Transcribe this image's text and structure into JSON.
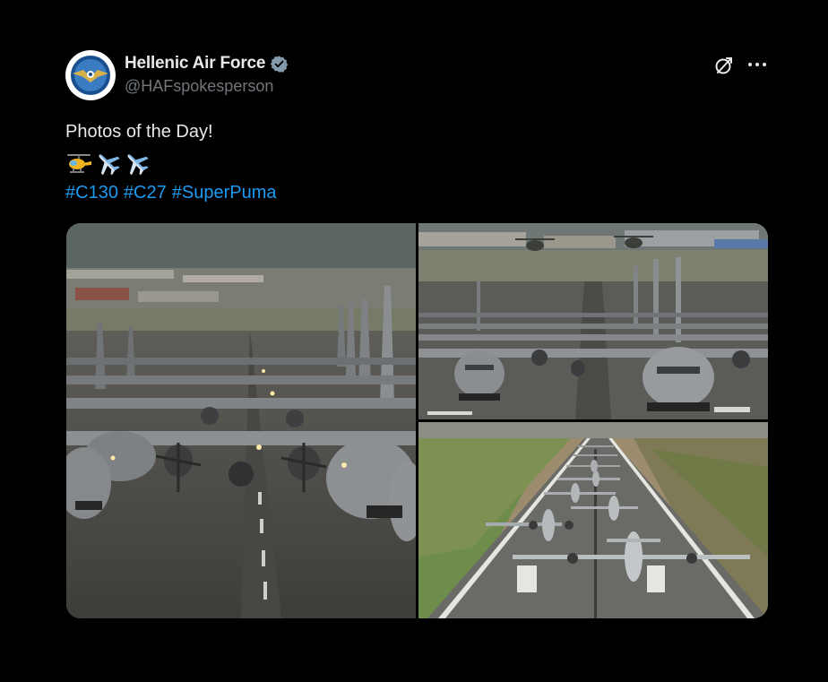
{
  "author": {
    "display_name": "Hellenic Air Force",
    "handle": "@HAFspokesperson",
    "verified": true,
    "avatar_icon": "hellenic-air-force-emblem"
  },
  "post": {
    "text": "Photos of the Day!",
    "emojis": [
      "helicopter",
      "airplane",
      "airplane"
    ],
    "hashtags": [
      "#C130",
      "#C27",
      "#SuperPuma"
    ]
  },
  "actions": {
    "grok_icon": "grok-icon",
    "more_icon": "more-icon"
  },
  "media": [
    {
      "icon": "photo",
      "subject": "aircraft-elephant-walk-close"
    },
    {
      "icon": "photo",
      "subject": "aircraft-elephant-walk-front"
    },
    {
      "icon": "photo",
      "subject": "aircraft-elephant-walk-aerial"
    }
  ],
  "colors": {
    "background": "#000000",
    "text": "#e7e9ea",
    "secondary_text": "#71767b",
    "link": "#1d9bf0",
    "verified_badge": "#829aab"
  }
}
